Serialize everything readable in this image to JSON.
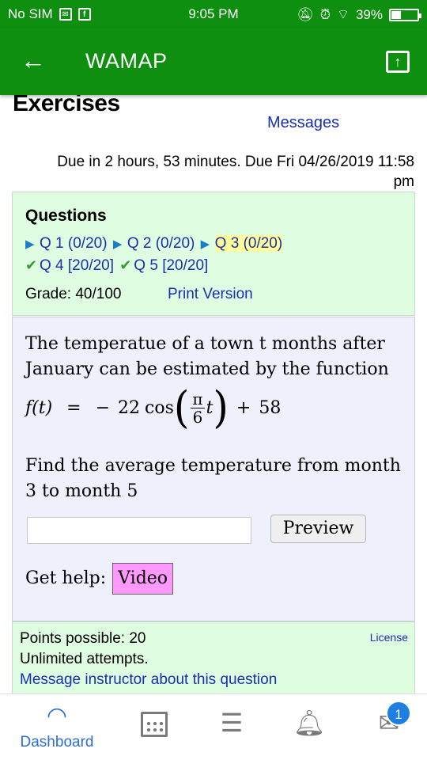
{
  "status_bar": {
    "carrier": "No SIM",
    "time": "9:05 PM",
    "battery": "39%",
    "battery_level": 0.39
  },
  "app_bar": {
    "title": "WAMAP",
    "back_icon": "arrow-left-icon",
    "action_icon": "open-external-icon"
  },
  "page": {
    "heading": "Exercises",
    "messages_link": "Messages",
    "due_text": "Due in 2 hours, 53 minutes. Due Fri 04/26/2019 11:58 pm"
  },
  "questions": {
    "heading": "Questions",
    "items": [
      {
        "label": "Q 1",
        "score": "(0/20)",
        "status": "play"
      },
      {
        "label": "Q 2",
        "score": "(0/20)",
        "status": "play"
      },
      {
        "label": "Q 3",
        "score": "(0/20)",
        "status": "current"
      },
      {
        "label": "Q 4",
        "score": "[20/20]",
        "status": "done"
      },
      {
        "label": "Q 5",
        "score": "[20/20]",
        "status": "done"
      }
    ],
    "grade": "Grade: 40/100",
    "print_version": "Print Version"
  },
  "problem": {
    "statement": "The temperatue of a town t months after January can be estimated by the function",
    "formula": {
      "lhs": "f(t)",
      "equals": "=",
      "minus": "−",
      "coef": "22",
      "func": "cos",
      "frac_num": "π",
      "frac_den": "6",
      "var": "t",
      "plus": "+",
      "constant": "58"
    },
    "question": "Find the average temperature from month 3 to month 5",
    "answer_value": "",
    "preview_label": "Preview",
    "help_label": "Get help:",
    "video_label": "Video"
  },
  "info": {
    "points": "Points possible: 20",
    "attempts": "Unlimited attempts.",
    "message_instructor": "Message instructor about this question",
    "license": "License"
  },
  "bottom_nav": {
    "dashboard_label": "Dashboard",
    "mail_badge": "1",
    "accent_color": "#2a6ed6"
  }
}
